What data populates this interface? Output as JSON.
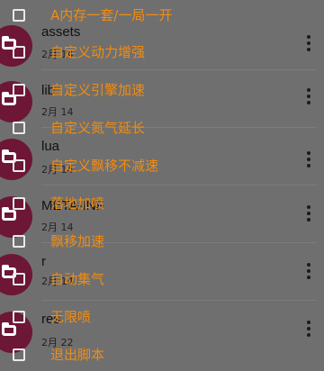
{
  "file_list": {
    "rows": [
      {
        "name": "assets",
        "date": "2月 14"
      },
      {
        "name": "lib",
        "date": "2月 14"
      },
      {
        "name": "lua",
        "date": "2月 14"
      },
      {
        "name": "META-INF",
        "date": "2月 14"
      },
      {
        "name": "r",
        "date": "2月 14"
      },
      {
        "name": "res",
        "date": "2月 22"
      }
    ],
    "more_icon": "more-vert-icon",
    "folder_icon": "folder-icon"
  },
  "cheat_menu": {
    "items": [
      {
        "label": "A内存一套/一局一开",
        "checked": false
      },
      {
        "label": "自定义动力增强",
        "checked": false
      },
      {
        "label": "自定义引擎加速",
        "checked": false
      },
      {
        "label": "自定义氮气延长",
        "checked": false
      },
      {
        "label": "自定义飘移不减速",
        "checked": false
      },
      {
        "label": "落地加喷",
        "checked": false
      },
      {
        "label": "飘移加速",
        "checked": false
      },
      {
        "label": "自动集气",
        "checked": false
      },
      {
        "label": "无限喷",
        "checked": false
      },
      {
        "label": "退出脚本",
        "checked": false
      }
    ]
  },
  "colors": {
    "overlay_background": "#6f6f6f",
    "menu_text": "#f28c10",
    "folder_icon": "#6d1636"
  }
}
